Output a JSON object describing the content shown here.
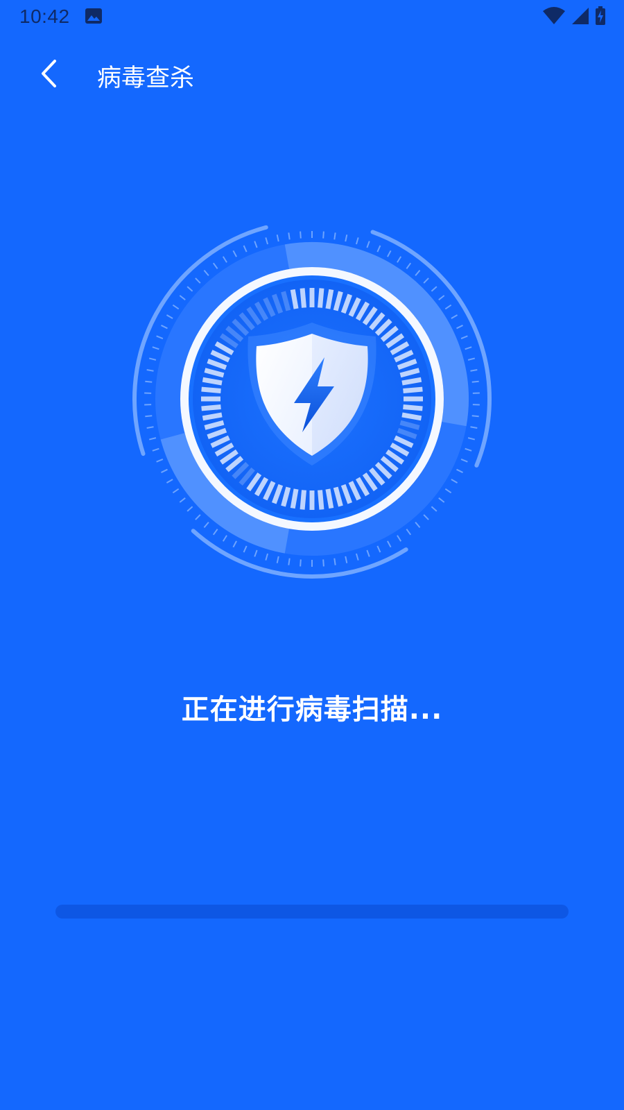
{
  "status_bar": {
    "time": "10:42",
    "icons": [
      "gallery-icon",
      "wifi-icon",
      "cell-signal-icon",
      "battery-charging-icon"
    ]
  },
  "header": {
    "back_icon": "chevron-left-icon",
    "title": "病毒查杀"
  },
  "scanner": {
    "center_icon": "shield-lightning-icon"
  },
  "scan": {
    "status_text": "正在进行病毒扫描...",
    "progress": 0
  },
  "colors": {
    "background": "#1468FE",
    "status_text": "#0F2A66",
    "progress_track": "#0E57E4",
    "shield_light": "#F4F8FF",
    "bolt": "#1468FE"
  }
}
